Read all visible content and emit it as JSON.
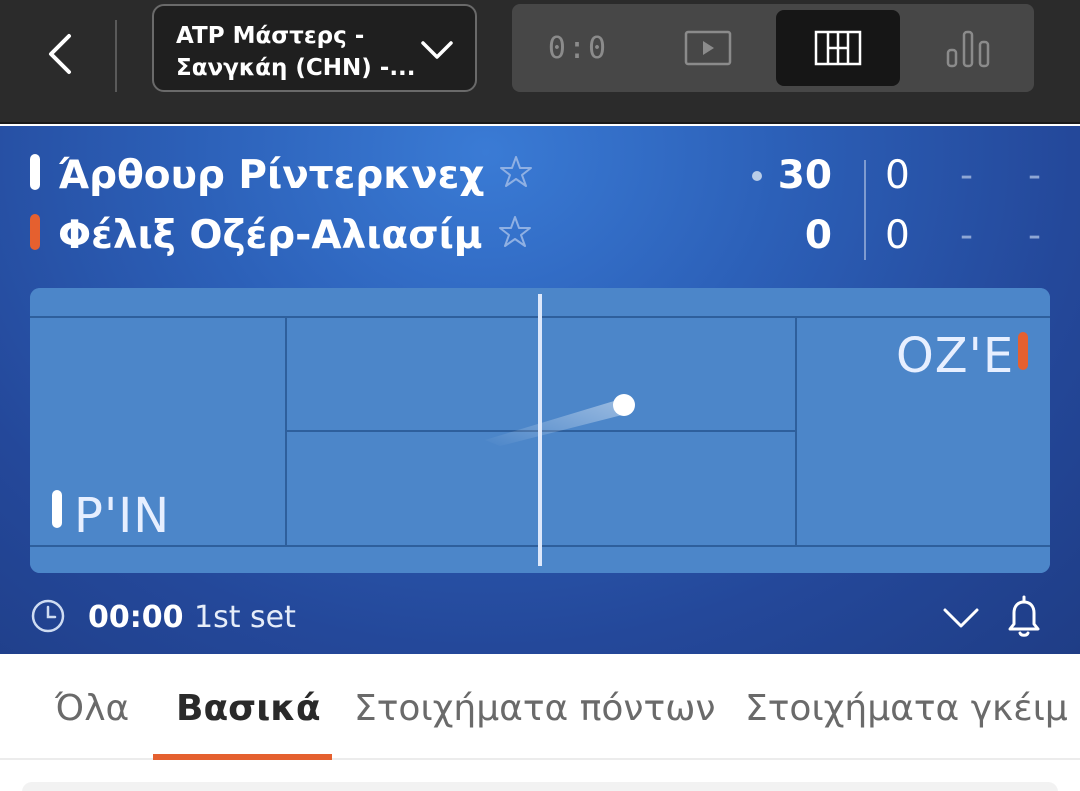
{
  "header": {
    "tournament_line1": "ATP Μάστερς -",
    "tournament_line2": "Σανγκάη (CHN) -...",
    "view_buttons": [
      {
        "name": "score",
        "icon": "scoreboard-icon",
        "label": "0:0",
        "active": false
      },
      {
        "name": "video",
        "icon": "play-icon",
        "active": false
      },
      {
        "name": "court",
        "icon": "court-grid-icon",
        "active": true
      },
      {
        "name": "stats",
        "icon": "bar-stats-icon",
        "active": false
      }
    ]
  },
  "match": {
    "players": [
      {
        "name": "Άρθουρ Ρίντερκνεχ",
        "color": "#ffffff",
        "points": "30",
        "serving": true,
        "set1": "0",
        "set2": "-",
        "set3": "-"
      },
      {
        "name": "Φέλιξ Οζέρ-Αλιασίμ",
        "color": "#e5602f",
        "points": "0",
        "serving": false,
        "set1": "0",
        "set2": "-",
        "set3": "-"
      }
    ],
    "court": {
      "left_label": "Ρ'ΙΝ",
      "right_label": "ΟΖ'Ε"
    },
    "time": "00:00",
    "set_label": "1st set"
  },
  "tabs": [
    {
      "label": "Όλα",
      "active": false
    },
    {
      "label": "Βασικά",
      "active": true
    },
    {
      "label": "Στοιχήματα πόντων",
      "active": false
    },
    {
      "label": "Στοιχήματα γκέιμ",
      "active": false
    }
  ],
  "colors": {
    "accent": "#e5602f",
    "topbar": "#2b2b2b",
    "match_bg": "#2c60b8",
    "court": "#4a84c8"
  }
}
